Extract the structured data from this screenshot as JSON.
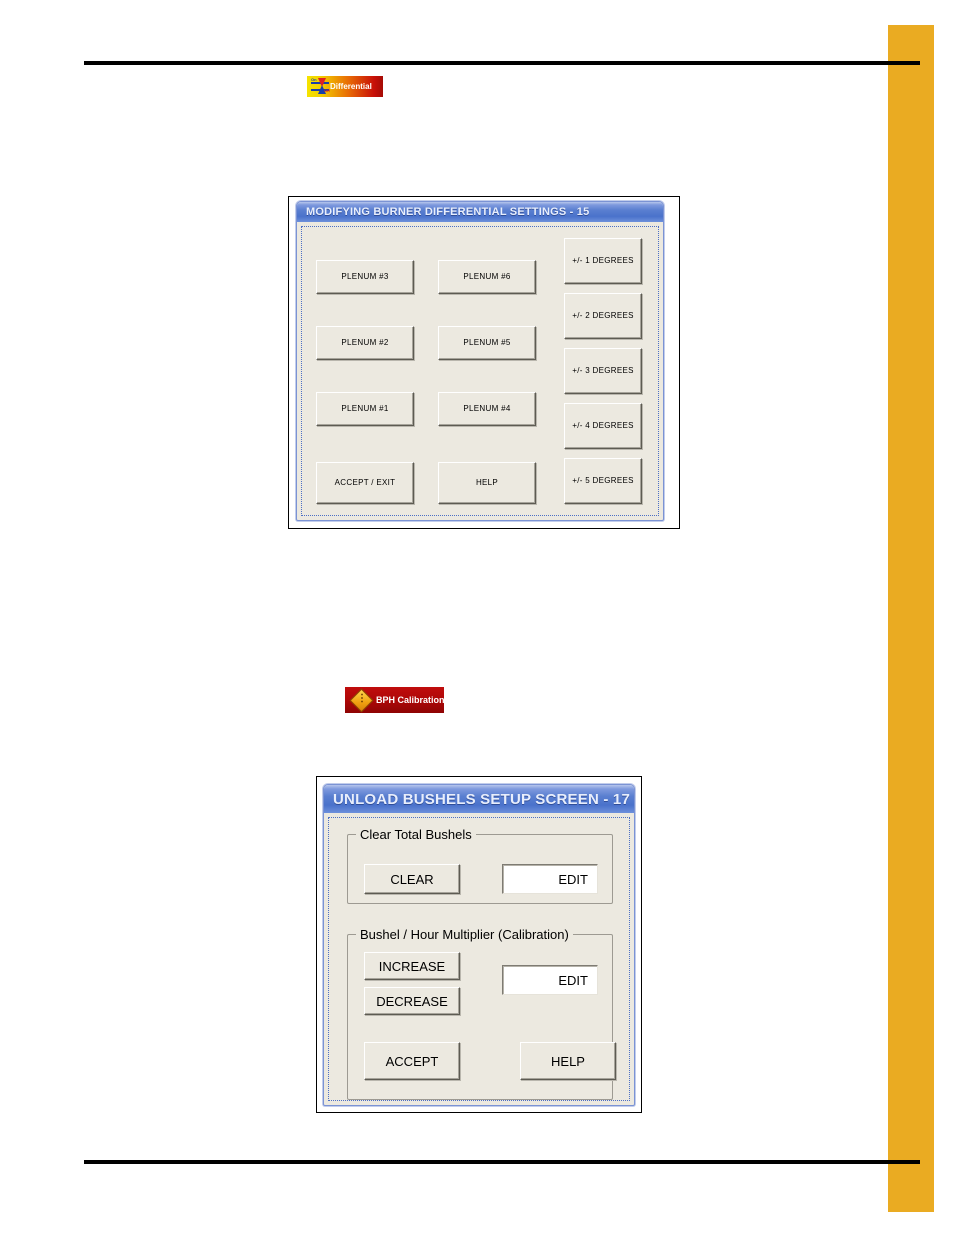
{
  "page": {
    "side_bar_color": "#eaab22",
    "rule_color": "#000000",
    "background": "#ffffff"
  },
  "badges": [
    {
      "name": "differential",
      "label": "Differential",
      "icon": "up-down-arrow-icon",
      "gradient_from": "#f5e400",
      "gradient_to": "#a50b06"
    },
    {
      "name": "bph-calibration",
      "label": "BPH Calibration",
      "icon": "diamond-warning-icon",
      "gradient_from": "#c00d0d",
      "gradient_to": "#8e0404"
    }
  ],
  "dialog_differential": {
    "title": "MODIFYING BURNER DIFFERENTIAL SETTINGS  -  15",
    "titlebar_color": "#4a72cb",
    "body_color": "#ece9e0",
    "plenum_buttons_col1": [
      {
        "label": "PLENUM #3"
      },
      {
        "label": "PLENUM #2"
      },
      {
        "label": "PLENUM #1"
      }
    ],
    "plenum_buttons_col2": [
      {
        "label": "PLENUM #6"
      },
      {
        "label": "PLENUM #5"
      },
      {
        "label": "PLENUM #4"
      }
    ],
    "degree_buttons": [
      {
        "label": "+/- 1 DEGREES"
      },
      {
        "label": "+/- 2 DEGREES"
      },
      {
        "label": "+/- 3 DEGREES"
      },
      {
        "label": "+/- 4 DEGREES"
      },
      {
        "label": "+/- 5 DEGREES"
      }
    ],
    "accept_exit_label": "ACCEPT / EXIT",
    "help_label": "HELP"
  },
  "dialog_bushels": {
    "title": "UNLOAD BUSHELS SETUP SCREEN - 17",
    "titlebar_color": "#4a72cb",
    "body_color": "#ece9e0",
    "group_clear": {
      "legend": "Clear Total Bushels",
      "clear_label": "CLEAR",
      "edit_value": "EDIT"
    },
    "group_multiplier": {
      "legend": "Bushel / Hour Multiplier (Calibration)",
      "increase_label": "INCREASE",
      "decrease_label": "DECREASE",
      "edit_value": "EDIT"
    },
    "accept_label": "ACCEPT",
    "help_label": "HELP"
  }
}
